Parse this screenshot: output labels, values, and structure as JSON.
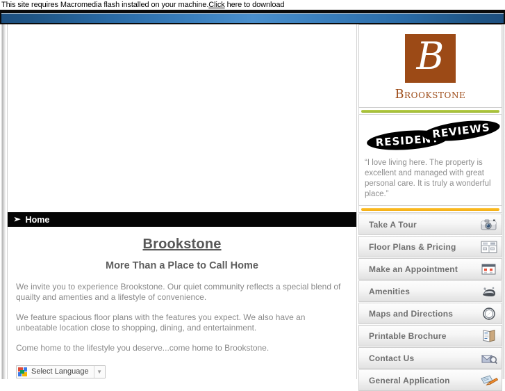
{
  "notice": {
    "text_before": "This site requires Macromedia flash installed on your machine.",
    "link": "Click",
    "text_after": " here to download"
  },
  "nav_bar": {
    "marker": "➤",
    "label": "Home"
  },
  "main": {
    "title": "Brookstone",
    "subtitle": "More Than a Place to Call Home",
    "paragraphs": [
      "We invite you to experience Brookstone. Our quiet community reflects a special blend of quailty and amenties and a lifestyle of convenience.",
      "We feature spacious floor plans with the features you expect. We also have an unbeatable location close to shopping, dining, and entertainment.",
      "Come home to the lifestyle you deserve...come home to Brookstone."
    ]
  },
  "translate": {
    "label": "Select Language",
    "arrow": "▼",
    "icon": "google-translate-icon"
  },
  "sidebar": {
    "logo": {
      "monogram": "B",
      "wordmark": "Brookstone",
      "square_color": "#9c4a16"
    },
    "dividers": {
      "green": "#9ab52e",
      "orange": "#f2a800"
    },
    "reviews": {
      "badge_line1": "RESIDENT",
      "badge_line2": "REVIEWS",
      "quote": "“I love living here. The property is excellent and managed with great personal care. It is truly a wonderful place.”"
    },
    "buttons": [
      {
        "label": "Take A Tour",
        "icon": "camera-icon"
      },
      {
        "label": "Floor Plans & Pricing",
        "icon": "floorplan-icon"
      },
      {
        "label": "Make an Appointment",
        "icon": "calendar-icon"
      },
      {
        "label": "Amenities",
        "icon": "amenities-icon"
      },
      {
        "label": "Maps and Directions",
        "icon": "compass-icon"
      },
      {
        "label": "Printable Brochure",
        "icon": "brochure-icon"
      },
      {
        "label": "Contact Us",
        "icon": "envelope-icon"
      },
      {
        "label": "General Application",
        "icon": "application-pencil-icon"
      }
    ]
  }
}
